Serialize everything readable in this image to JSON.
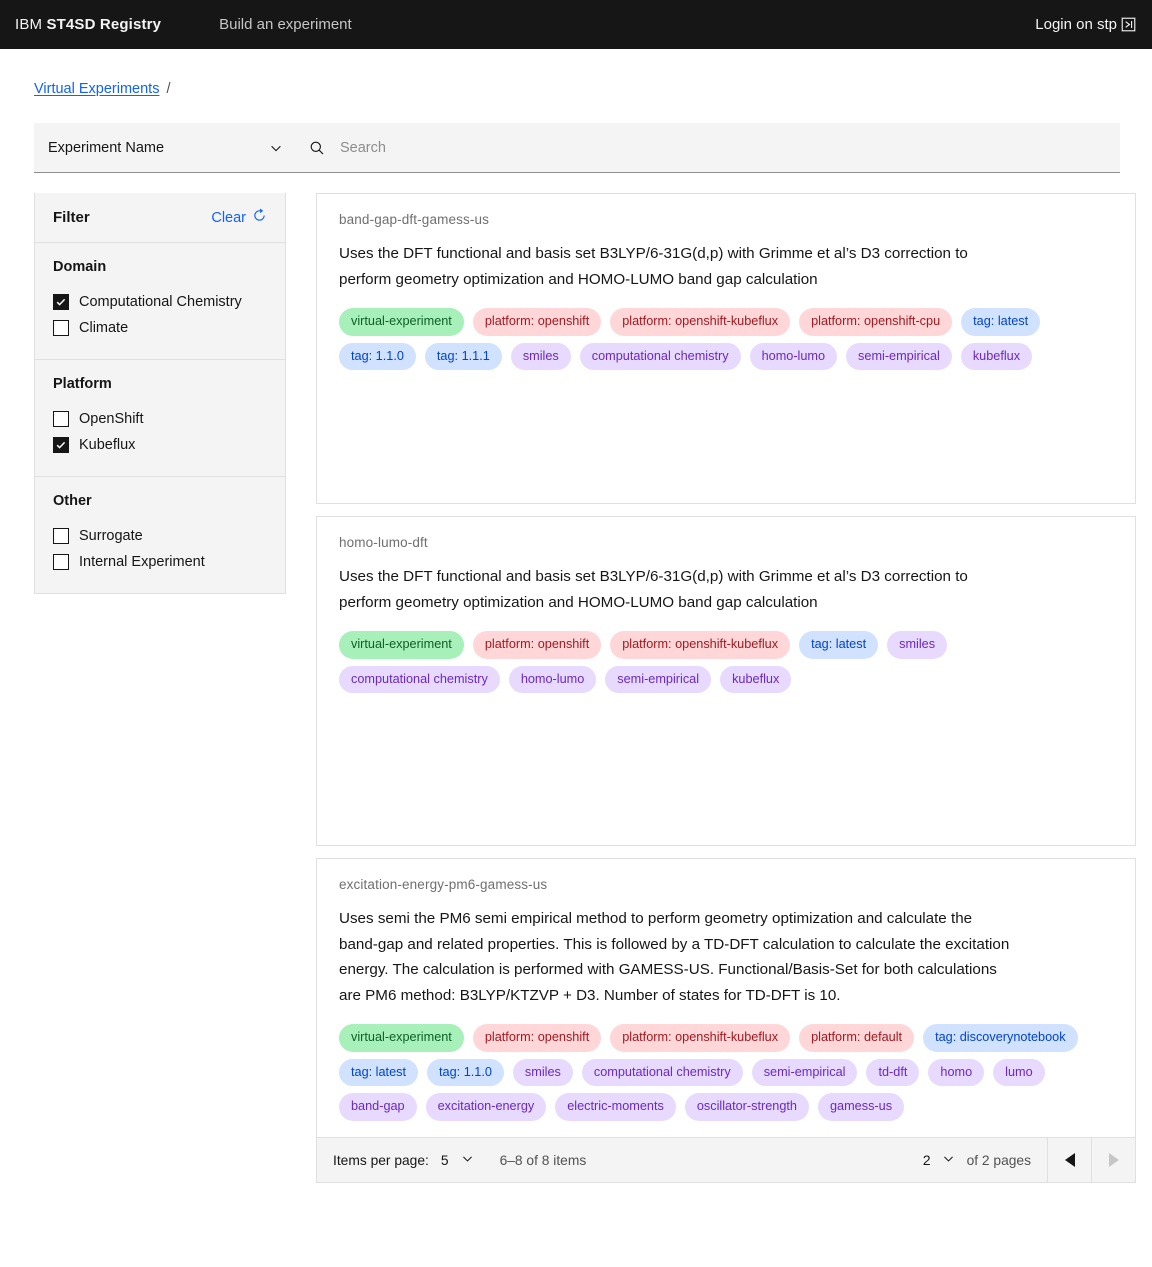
{
  "header": {
    "brand_prefix": "IBM",
    "brand_name": "ST4SD Registry",
    "nav_item": "Build an experiment",
    "login_label": "Login on stp",
    "launch_icon": "launch-icon",
    "bg_color": "#161616"
  },
  "breadcrumb": {
    "link": "Virtual Experiments",
    "separator": "/"
  },
  "search": {
    "select_value": "Experiment Name",
    "placeholder": "Search",
    "value": "",
    "search_icon": "search-icon",
    "chevron_icon": "chevron-down-icon"
  },
  "filter": {
    "title": "Filter",
    "clear_label": "Clear",
    "clear_icon": "reset-icon",
    "groups": [
      {
        "title": "Domain",
        "options": [
          {
            "label": "Computational Chemistry",
            "checked": true
          },
          {
            "label": "Climate",
            "checked": false
          }
        ]
      },
      {
        "title": "Platform",
        "options": [
          {
            "label": "OpenShift",
            "checked": false
          },
          {
            "label": "Kubeflux",
            "checked": true
          }
        ]
      },
      {
        "title": "Other",
        "options": [
          {
            "label": "Surrogate",
            "checked": false
          },
          {
            "label": "Internal Experiment",
            "checked": false
          }
        ]
      }
    ]
  },
  "results": {
    "cards": [
      {
        "id": "band-gap-dft-gamess-us",
        "description": "Uses the DFT functional and basis set B3LYP/6-31G(d,p) with Grimme et al’s D3 correction to perform geometry optimization and HOMO-LUMO band gap calculation",
        "tags": [
          {
            "label": "virtual-experiment",
            "color": "green"
          },
          {
            "label": "platform: openshift",
            "color": "red"
          },
          {
            "label": "platform: openshift-kubeflux",
            "color": "red"
          },
          {
            "label": "platform: openshift-cpu",
            "color": "red"
          },
          {
            "label": "tag: latest",
            "color": "blue"
          },
          {
            "label": "tag: 1.1.0",
            "color": "blue"
          },
          {
            "label": "tag: 1.1.1",
            "color": "blue"
          },
          {
            "label": "smiles",
            "color": "purple"
          },
          {
            "label": "computational chemistry",
            "color": "purple"
          },
          {
            "label": "homo-lumo",
            "color": "purple"
          },
          {
            "label": "semi-empirical",
            "color": "purple"
          },
          {
            "label": "kubeflux",
            "color": "purple"
          }
        ]
      },
      {
        "id": "homo-lumo-dft",
        "description": "Uses the DFT functional and basis set B3LYP/6-31G(d,p) with Grimme et al’s D3 correction to perform geometry optimization and HOMO-LUMO band gap calculation",
        "tags": [
          {
            "label": "virtual-experiment",
            "color": "green"
          },
          {
            "label": "platform: openshift",
            "color": "red"
          },
          {
            "label": "platform: openshift-kubeflux",
            "color": "red"
          },
          {
            "label": "tag: latest",
            "color": "blue"
          },
          {
            "label": "smiles",
            "color": "purple"
          },
          {
            "label": "computational chemistry",
            "color": "purple"
          },
          {
            "label": "homo-lumo",
            "color": "purple"
          },
          {
            "label": "semi-empirical",
            "color": "purple"
          },
          {
            "label": "kubeflux",
            "color": "purple"
          }
        ]
      },
      {
        "id": "excitation-energy-pm6-gamess-us",
        "description": "Uses semi the PM6 semi empirical method to perform geometry optimization and calculate the band-gap and related properties. This is followed by a TD-DFT calculation to calculate the excitation energy. The calculation is performed with GAMESS-US. Functional/Basis-Set for both calculations are PM6 method: B3LYP/KTZVP + D3. Number of states for TD-DFT is 10.",
        "tags": [
          {
            "label": "virtual-experiment",
            "color": "green"
          },
          {
            "label": "platform: openshift",
            "color": "red"
          },
          {
            "label": "platform: openshift-kubeflux",
            "color": "red"
          },
          {
            "label": "platform: default",
            "color": "red"
          },
          {
            "label": "tag: discoverynotebook",
            "color": "blue"
          },
          {
            "label": "tag: latest",
            "color": "blue"
          },
          {
            "label": "tag: 1.1.0",
            "color": "blue"
          },
          {
            "label": "smiles",
            "color": "purple"
          },
          {
            "label": "computational chemistry",
            "color": "purple"
          },
          {
            "label": "semi-empirical",
            "color": "purple"
          },
          {
            "label": "td-dft",
            "color": "purple"
          },
          {
            "label": "homo",
            "color": "purple"
          },
          {
            "label": "lumo",
            "color": "purple"
          },
          {
            "label": "band-gap",
            "color": "purple"
          },
          {
            "label": "excitation-energy",
            "color": "purple"
          },
          {
            "label": "electric-moments",
            "color": "purple"
          },
          {
            "label": "oscillator-strength",
            "color": "purple"
          },
          {
            "label": "gamess-us",
            "color": "purple"
          }
        ]
      }
    ]
  },
  "pagination": {
    "items_per_page_label": "Items per page:",
    "items_per_page_value": "5",
    "range_text": "6–8 of 8 items",
    "page_value": "2",
    "page_total_text": "of 2 pages",
    "prev_icon": "caret-left-icon",
    "next_icon": "caret-right-icon"
  },
  "colors": {
    "accent_blue": "#0f62fe",
    "tag_green_bg": "#a7f0ba",
    "tag_green_fg": "#0e6027",
    "tag_red_bg": "#ffd7d9",
    "tag_red_fg": "#a2191f",
    "tag_blue_bg": "#d0e2ff",
    "tag_blue_fg": "#0043ce",
    "tag_purple_bg": "#e8daff",
    "tag_purple_fg": "#6929c4"
  }
}
